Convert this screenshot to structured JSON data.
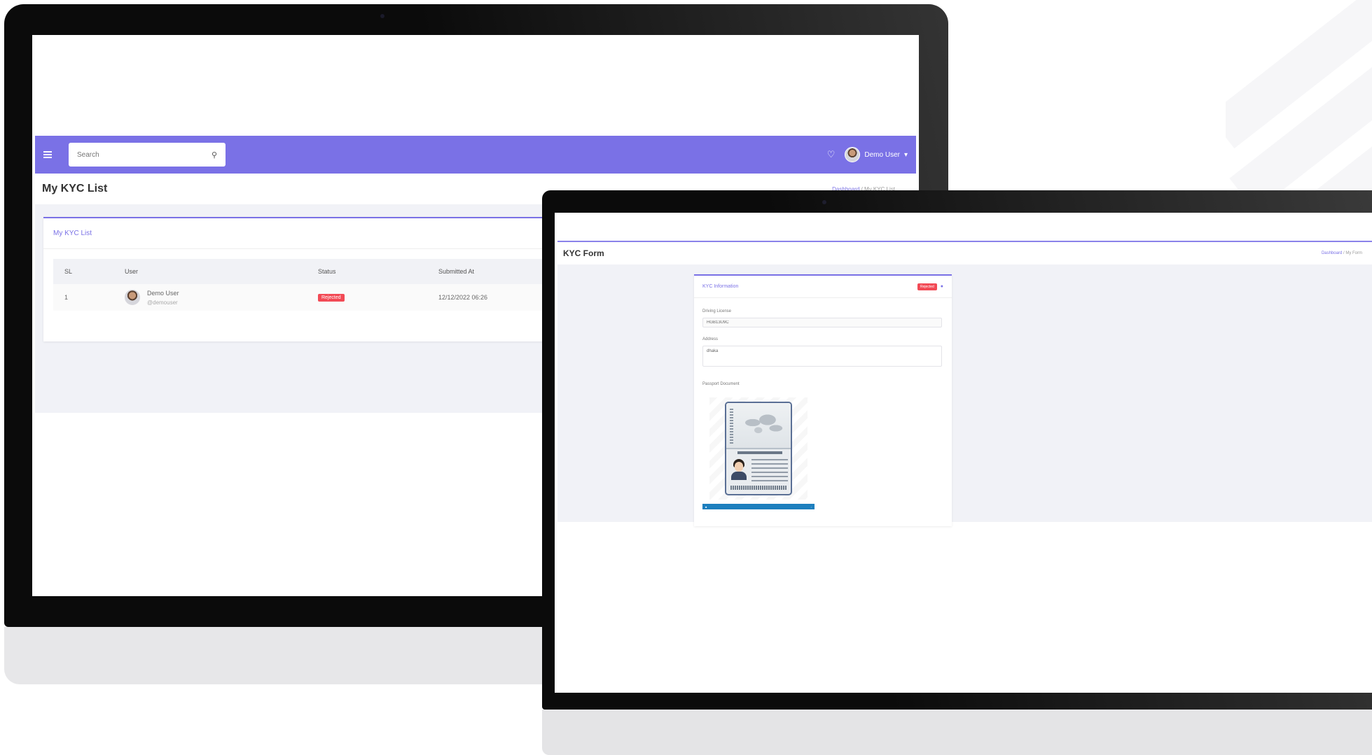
{
  "desktop": {
    "navbar": {
      "search_placeholder": "Search",
      "user_name": "Demo User"
    },
    "page": {
      "title": "My KYC List",
      "breadcrumb": [
        "Dashboard",
        "My KYC List"
      ]
    },
    "card": {
      "title": "My KYC List",
      "columns": [
        "SL",
        "User",
        "Status",
        "Submitted At"
      ],
      "rows": [
        {
          "sl": "1",
          "user_name": "Demo User",
          "user_handle": "@demouser",
          "status": "Rejected",
          "submitted_at": "12/12/2022 06:26"
        }
      ]
    }
  },
  "laptop": {
    "page": {
      "title": "KYC Form",
      "breadcrumb": [
        "Dashboard",
        "My Form"
      ]
    },
    "card": {
      "title": "KYC Information",
      "status": "Rejected",
      "fields": {
        "driving_license_label": "Driving License",
        "driving_license_value": "HGB13U9C",
        "address_label": "Address",
        "address_value": "dhaka",
        "passport_label": "Passport Document"
      }
    }
  },
  "colors": {
    "primary": "#7a71e6",
    "danger": "#f24a55",
    "content_bg": "#f1f2f7"
  }
}
